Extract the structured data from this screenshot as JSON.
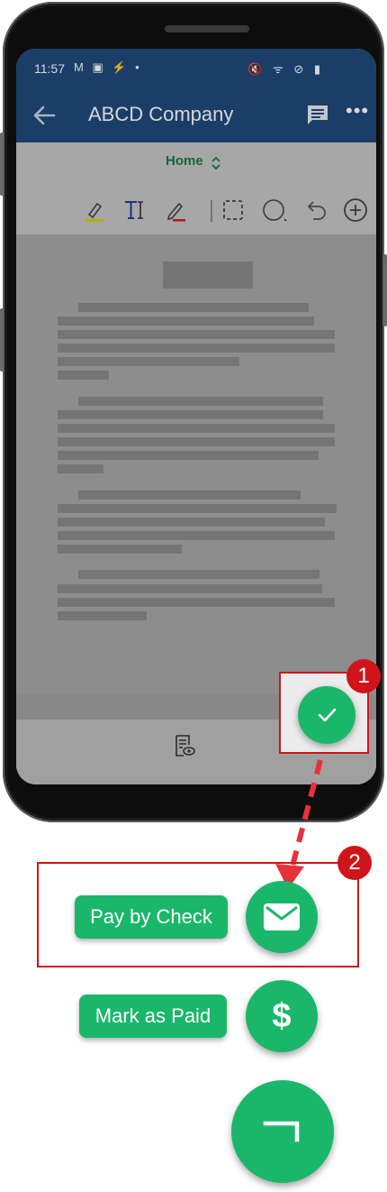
{
  "status": {
    "time": "11:57",
    "left_icons": "M ▣ ⚡ •",
    "right_icons": "🔇 ᯤ ⊘ ▮"
  },
  "appbar": {
    "title": "ABCD Company",
    "back_icon": "arrow-back-icon",
    "comment_icon": "comment-icon",
    "more_icon": "more-icon",
    "more_glyph": "•••"
  },
  "toolbar": {
    "tab_label": "Home",
    "tab_chevron": "⌃⌄",
    "tools": [
      "highlighter-icon",
      "text-icon",
      "pen-icon",
      "select-icon",
      "shape-icon",
      "undo-icon",
      "add-icon"
    ]
  },
  "actions": {
    "pay_by_check": "Pay by Check",
    "mark_as_paid": "Mark as Paid",
    "dollar_glyph": "$",
    "close_glyph": "¬"
  },
  "badges": {
    "one": "1",
    "two": "2"
  },
  "colors": {
    "accent_green": "#1ab76a",
    "app_blue": "#1f4a7c",
    "highlight_red": "#d0141b"
  }
}
